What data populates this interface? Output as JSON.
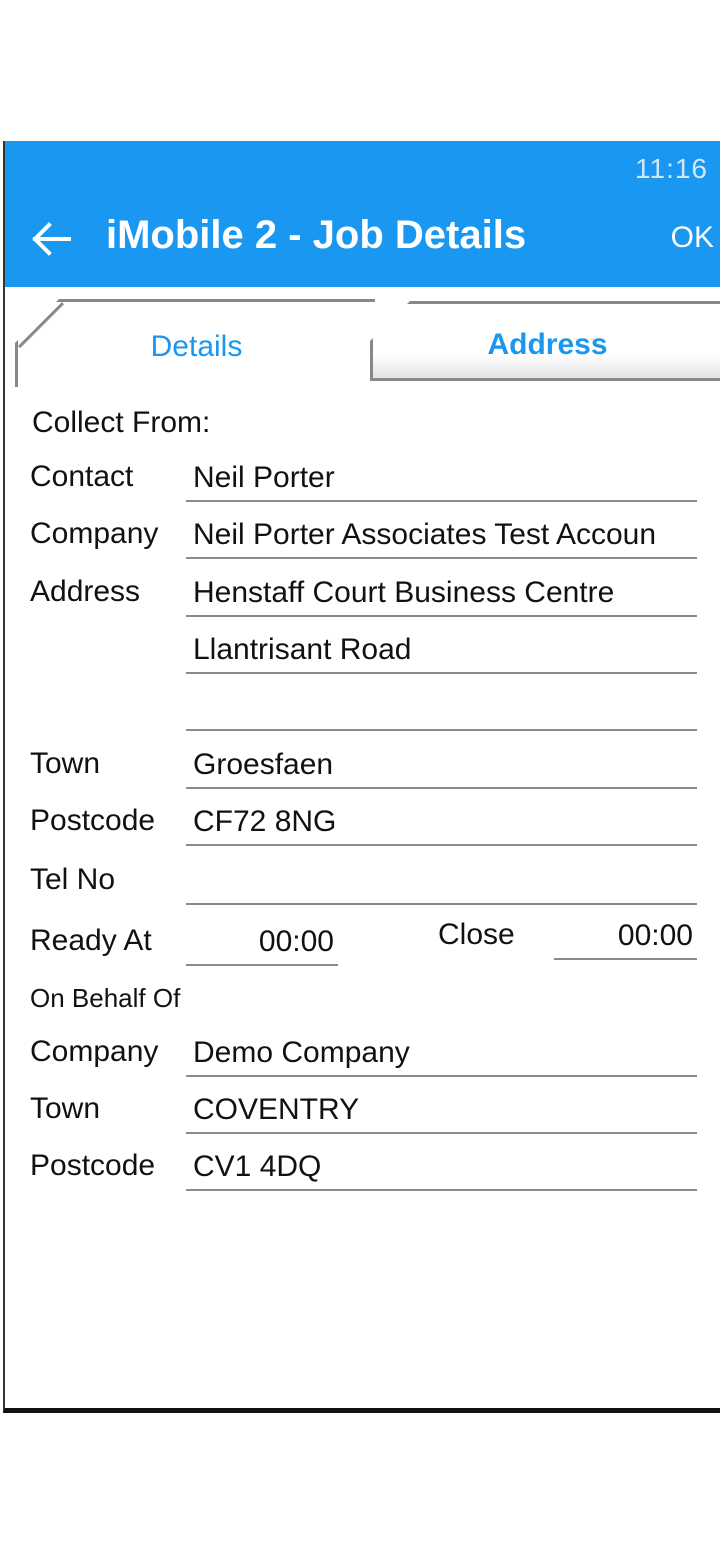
{
  "status_bar": {
    "time": "11:16"
  },
  "app_bar": {
    "title": "iMobile 2 - Job Details",
    "ok_label": "OK"
  },
  "tabs": [
    {
      "label": "Details",
      "selected": false
    },
    {
      "label": "Address",
      "selected": true
    }
  ],
  "collect_from": {
    "heading": "Collect From:",
    "contact_label": "Contact",
    "contact": "Neil Porter",
    "company_label": "Company",
    "company": "Neil Porter Associates Test Accoun",
    "address_label": "Address",
    "address_line1": "Henstaff Court Business Centre",
    "address_line2": "Llantrisant Road",
    "address_line3": "",
    "town_label": "Town",
    "town": "Groesfaen",
    "postcode_label": "Postcode",
    "postcode": "CF72 8NG",
    "tel_label": "Tel No",
    "tel": "",
    "ready_label": "Ready At",
    "ready_at": "00:00",
    "close_label": "Close",
    "close": "00:00"
  },
  "on_behalf_of": {
    "heading": "On Behalf Of",
    "company_label": "Company",
    "company": "Demo Company",
    "town_label": "Town",
    "town": "COVENTRY",
    "postcode_label": "Postcode",
    "postcode": "CV1 4DQ"
  },
  "colors": {
    "accent": "#1a97f0"
  },
  "icons": {
    "back": "arrow-left-icon"
  }
}
